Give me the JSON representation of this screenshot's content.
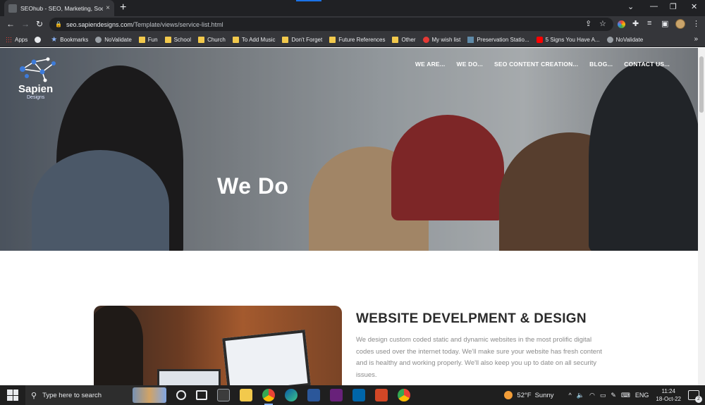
{
  "browser": {
    "tab": {
      "title": "SEOhub - SEO, Marketing, Social",
      "close": "×"
    },
    "new_tab": "+",
    "window_controls": {
      "dropdown": "⌄",
      "minimize": "—",
      "restore": "❐",
      "close": "✕"
    },
    "url_host": "seo.sapiendesigns.com",
    "url_path": "/Template/views/service-list.html",
    "bookmarks": [
      {
        "label": "Apps",
        "icon": "apps-grid-icon"
      },
      {
        "label": "",
        "icon": "github-icon"
      },
      {
        "label": "Bookmarks",
        "icon": "star-icon"
      },
      {
        "label": "NoValidate",
        "icon": "globe-icon"
      },
      {
        "label": "Fun",
        "icon": "folder-icon"
      },
      {
        "label": "School",
        "icon": "folder-icon"
      },
      {
        "label": "Church",
        "icon": "folder-icon"
      },
      {
        "label": "To Add Music",
        "icon": "folder-icon"
      },
      {
        "label": "Don't Forget",
        "icon": "folder-icon"
      },
      {
        "label": "Future References",
        "icon": "folder-icon"
      },
      {
        "label": "Other",
        "icon": "folder-icon"
      },
      {
        "label": "My wish list",
        "icon": "wishlist-icon"
      },
      {
        "label": "Preservation Statio...",
        "icon": "page-icon"
      },
      {
        "label": "5 Signs You Have A...",
        "icon": "youtube-icon"
      },
      {
        "label": "NoValidate",
        "icon": "globe-icon"
      }
    ],
    "bookmarks_more": "»"
  },
  "site": {
    "logo_name": "Sapien",
    "logo_sub": "Designs",
    "nav": [
      "WE ARE...",
      "WE DO...",
      "SEO CONTENT CREATION...",
      "BLOG...",
      "CONTACT US..."
    ],
    "hero_title": "We Do",
    "service_title": "WEBSITE DEVELPMENT & DESIGN",
    "service_desc": "We design custom coded static and dynamic websites in the most prolific digital codes used over the internet today. We'll make sure your website has fresh content and is healthy and working properly. We'll also keep you up to date on all security issues."
  },
  "taskbar": {
    "search_placeholder": "Type here to search",
    "weather_temp": "52°F",
    "weather_text": "Sunny",
    "language": "ENG",
    "time": "11:24",
    "date": "18-Oct-22",
    "notifications": "2"
  },
  "colors": {
    "chrome_dark": "#202124",
    "chrome_toolbar": "#35363a",
    "heading": "#2b2b2b",
    "body_text": "#8a8a8a"
  }
}
